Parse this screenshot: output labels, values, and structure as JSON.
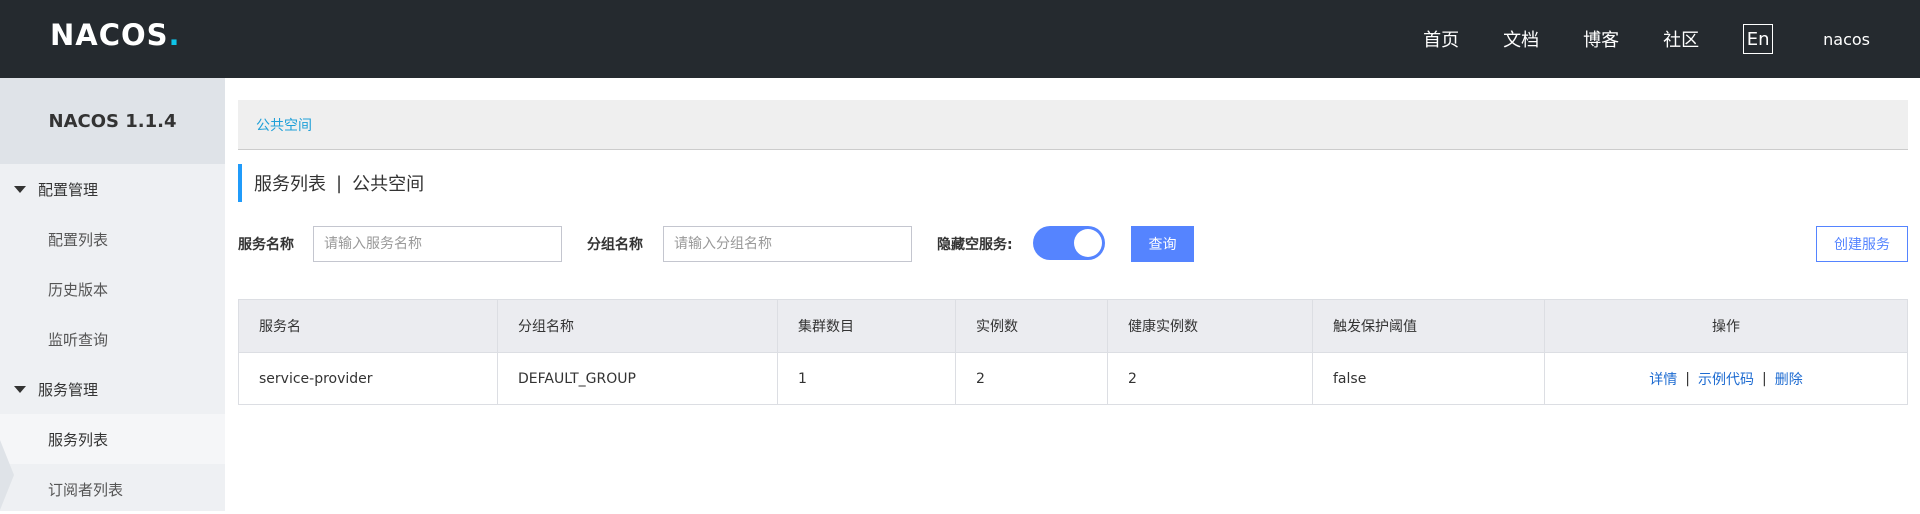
{
  "header": {
    "logo_text": "NACOS",
    "logo_dot": ".",
    "nav": [
      "首页",
      "文档",
      "博客",
      "社区"
    ],
    "lang": "En",
    "user": "nacos"
  },
  "sidebar": {
    "title": "NACOS 1.1.4",
    "groups": [
      {
        "label": "配置管理",
        "items": [
          "配置列表",
          "历史版本",
          "监听查询"
        ]
      },
      {
        "label": "服务管理",
        "items": [
          "服务列表",
          "订阅者列表"
        ]
      }
    ],
    "active_item": "服务列表"
  },
  "breadcrumb": "公共空间",
  "page_title": {
    "main": "服务列表",
    "separator": "|",
    "namespace": "公共空间"
  },
  "search": {
    "service_label": "服务名称",
    "service_placeholder": "请输入服务名称",
    "group_label": "分组名称",
    "group_placeholder": "请输入分组名称",
    "hide_empty_label": "隐藏空服务:",
    "hide_empty_on": true,
    "query_button": "查询",
    "create_button": "创建服务"
  },
  "table": {
    "headers": [
      "服务名",
      "分组名称",
      "集群数目",
      "实例数",
      "健康实例数",
      "触发保护阈值",
      "操作"
    ],
    "rows": [
      {
        "service": "service-provider",
        "group": "DEFAULT_GROUP",
        "clusters": "1",
        "instances": "2",
        "healthy": "2",
        "threshold": "false",
        "ops": {
          "detail": "详情",
          "sample": "示例代码",
          "delete": "删除",
          "sep": "|"
        }
      }
    ]
  },
  "colors": {
    "header_bg": "#252a2f",
    "accent": "#5584ff",
    "logo_accent": "#0ec4e8",
    "link": "#1d6bd1"
  },
  "icons": [
    "caret-down-icon"
  ]
}
